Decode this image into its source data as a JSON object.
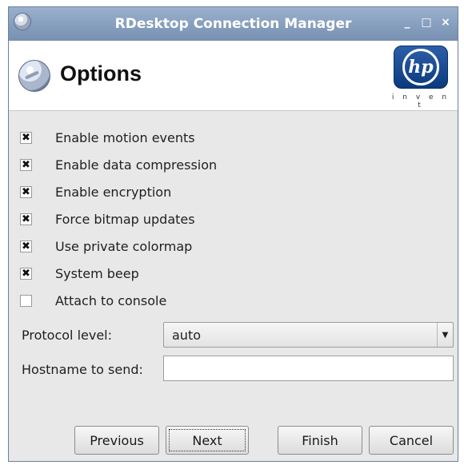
{
  "window": {
    "title": "RDesktop Connection Manager",
    "controls": {
      "minimize": "_",
      "maximize": "□",
      "close": "×"
    }
  },
  "header": {
    "title": "Options",
    "logo_text": "hp",
    "logo_tagline": "i n v e n t"
  },
  "options": [
    {
      "label": "Enable motion events",
      "checked": true,
      "mark": "✖"
    },
    {
      "label": "Enable data compression",
      "checked": true,
      "mark": "✖"
    },
    {
      "label": "Enable encryption",
      "checked": true,
      "mark": "✖"
    },
    {
      "label": "Force bitmap updates",
      "checked": true,
      "mark": "✖"
    },
    {
      "label": "Use private colormap",
      "checked": true,
      "mark": "✖"
    },
    {
      "label": "System beep",
      "checked": true,
      "mark": "✖"
    },
    {
      "label": "Attach to console",
      "checked": false,
      "mark": ""
    }
  ],
  "protocol": {
    "label": "Protocol level:",
    "value": "auto"
  },
  "hostname": {
    "label": "Hostname to send:",
    "value": ""
  },
  "buttons": {
    "previous": "Previous",
    "next": "Next",
    "finish": "Finish",
    "cancel": "Cancel"
  },
  "colors": {
    "titlebar": "#7790b2",
    "hp_blue": "#1a4b92",
    "background": "#e8e8e8"
  }
}
